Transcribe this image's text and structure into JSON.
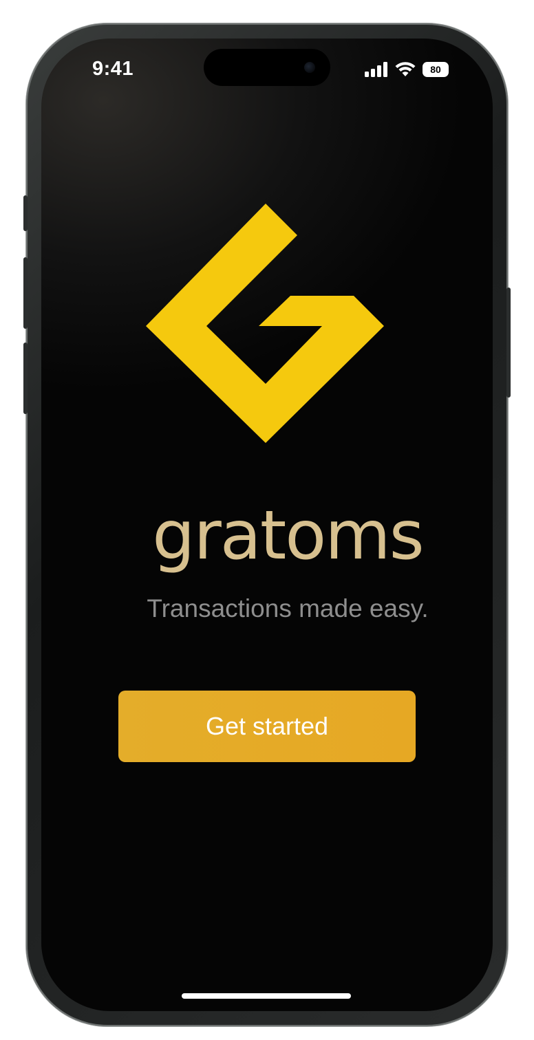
{
  "status_bar": {
    "time": "9:41",
    "battery_level": "80",
    "icons": [
      "cellular-signal-icon",
      "wifi-icon",
      "battery-icon"
    ]
  },
  "brand": {
    "name": "gratoms",
    "tagline": "Transactions made easy.",
    "logo": "gratoms-logo-icon",
    "colors": {
      "logo": "#F5C90E",
      "wordmark": "#D7C08F",
      "tagline": "#8E8E8E",
      "button": "#E4AD2A",
      "background": "#050505"
    }
  },
  "actions": {
    "get_started_label": "Get started"
  }
}
